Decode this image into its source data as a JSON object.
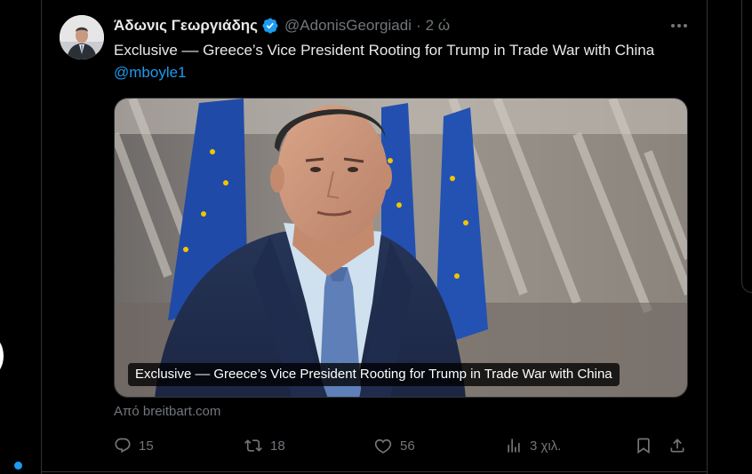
{
  "tweet": {
    "author_name": "Άδωνις Γεωργιάδης",
    "handle": "@AdonisGeorgiadi",
    "separator": "·",
    "time": "2 ώ",
    "text": "Exclusive –– Greece’s Vice President Rooting for Trump in Trade War with China",
    "mention": "@mboyle1"
  },
  "card": {
    "caption": "Exclusive –– Greece’s Vice President Rooting for Trump in Trade War with China",
    "source": "Από breitbart.com"
  },
  "actions": {
    "replies": "15",
    "retweets": "18",
    "likes": "56",
    "views": "3 χιλ."
  },
  "colors": {
    "background": "#000000",
    "text": "#e7e9ea",
    "secondary": "#71767b",
    "accent": "#1d9bf0",
    "border": "#2f3336"
  },
  "icons": {
    "verified": "verified-badge-icon",
    "more": "more-dots-icon",
    "reply": "reply-bubble-icon",
    "retweet": "retweet-icon",
    "like": "heart-icon",
    "views": "bar-chart-icon",
    "bookmark": "bookmark-icon",
    "share": "share-upload-icon"
  }
}
